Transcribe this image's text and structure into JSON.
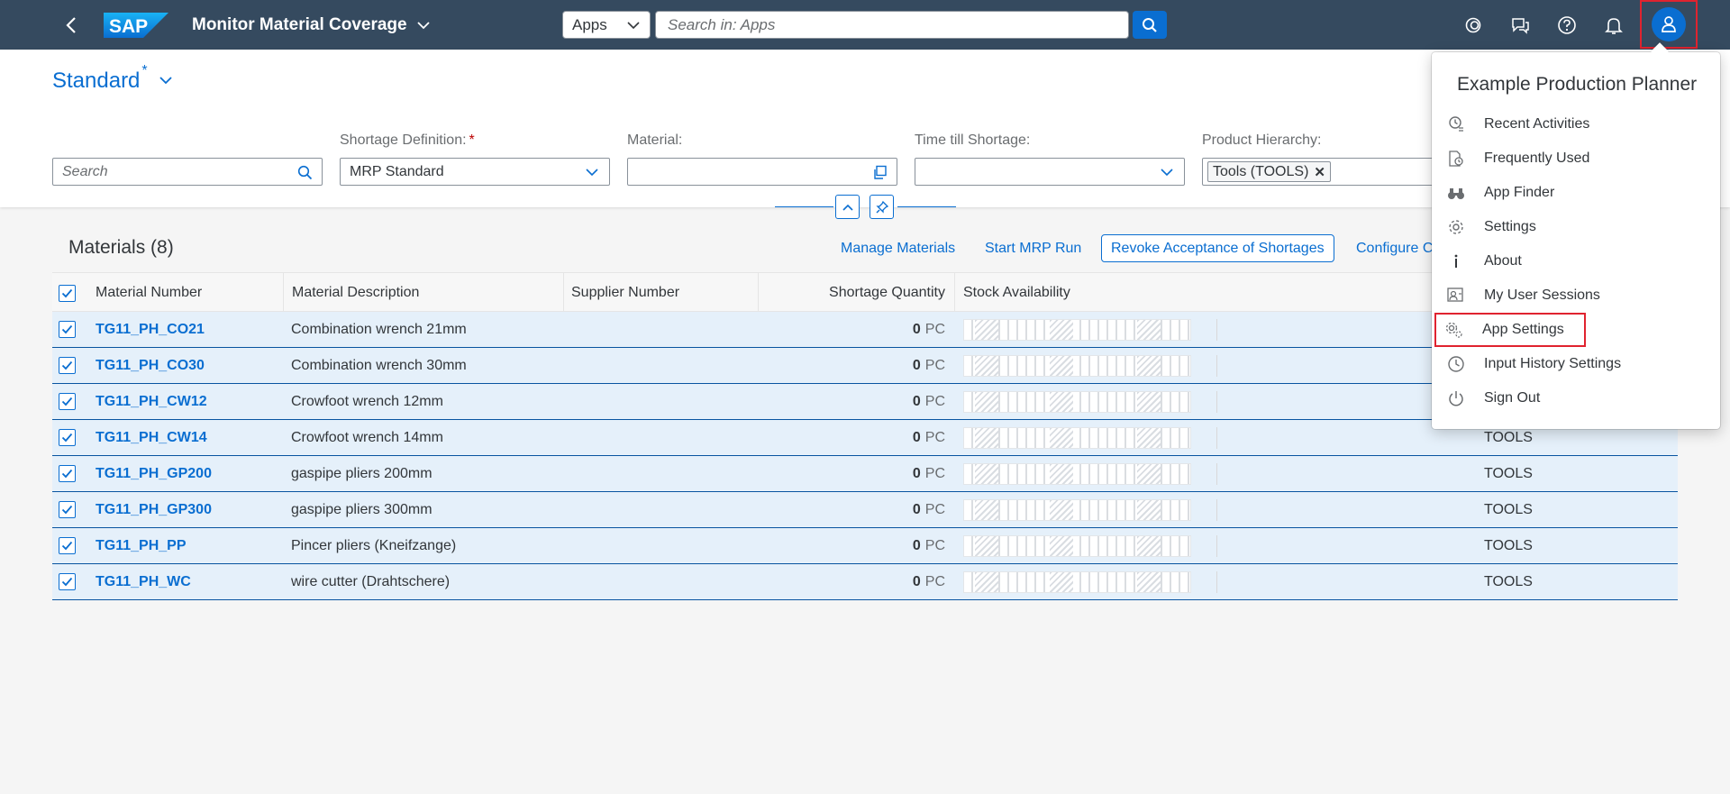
{
  "shell": {
    "title": "Monitor Material Coverage",
    "scope": "Apps",
    "search_placeholder": "Search in: Apps"
  },
  "variant": {
    "name": "Standard",
    "modified_marker": "*"
  },
  "filters": {
    "search_placeholder": "Search",
    "shortage_definition": {
      "label": "Shortage Definition:",
      "required_marker": "*",
      "value": "MRP Standard"
    },
    "material": {
      "label": "Material:",
      "value": ""
    },
    "time_till_shortage": {
      "label": "Time till Shortage:",
      "value": ""
    },
    "product_hierarchy": {
      "label": "Product Hierarchy:",
      "token": "Tools (TOOLS)"
    }
  },
  "table": {
    "title": "Materials (8)",
    "actions": [
      "Manage Materials",
      "Start MRP Run",
      "Revoke Acceptance of Shortages",
      "Configure C"
    ],
    "columns": [
      "Material Number",
      "Material Description",
      "Supplier Number",
      "Shortage Quantity",
      "Stock Availability"
    ],
    "rows": [
      {
        "number": "TG11_PH_CO21",
        "description": "Combination wrench 21mm",
        "supplier": "",
        "qty": "0",
        "unit": "PC",
        "hierarchy": ""
      },
      {
        "number": "TG11_PH_CO30",
        "description": "Combination wrench 30mm",
        "supplier": "",
        "qty": "0",
        "unit": "PC",
        "hierarchy": ""
      },
      {
        "number": "TG11_PH_CW12",
        "description": "Crowfoot wrench 12mm",
        "supplier": "",
        "qty": "0",
        "unit": "PC",
        "hierarchy": ""
      },
      {
        "number": "TG11_PH_CW14",
        "description": "Crowfoot wrench 14mm",
        "supplier": "",
        "qty": "0",
        "unit": "PC",
        "hierarchy": "TOOLS"
      },
      {
        "number": "TG11_PH_GP200",
        "description": "gaspipe pliers 200mm",
        "supplier": "",
        "qty": "0",
        "unit": "PC",
        "hierarchy": "TOOLS"
      },
      {
        "number": "TG11_PH_GP300",
        "description": "gaspipe pliers 300mm",
        "supplier": "",
        "qty": "0",
        "unit": "PC",
        "hierarchy": "TOOLS"
      },
      {
        "number": "TG11_PH_PP",
        "description": "Pincer pliers (Kneifzange)",
        "supplier": "",
        "qty": "0",
        "unit": "PC",
        "hierarchy": "TOOLS"
      },
      {
        "number": "TG11_PH_WC",
        "description": "wire cutter (Drahtschere)",
        "supplier": "",
        "qty": "0",
        "unit": "PC",
        "hierarchy": "TOOLS"
      }
    ]
  },
  "user_menu": {
    "user_name": "Example Production Planner",
    "items": [
      {
        "label": "Recent Activities",
        "icon": "recent-activities-icon"
      },
      {
        "label": "Frequently Used",
        "icon": "frequently-used-icon"
      },
      {
        "label": "App Finder",
        "icon": "binoculars-icon"
      },
      {
        "label": "Settings",
        "icon": "gear-icon"
      },
      {
        "label": "About",
        "icon": "info-icon"
      },
      {
        "label": "My User Sessions",
        "icon": "user-sessions-icon"
      },
      {
        "label": "App Settings",
        "icon": "app-settings-icon"
      },
      {
        "label": "Input History Settings",
        "icon": "history-icon"
      },
      {
        "label": "Sign Out",
        "icon": "power-icon"
      }
    ]
  },
  "colors": {
    "shell": "#354a5f",
    "accent": "#0a6ed1",
    "selected_row": "#e5f0fa",
    "highlight_box": "#e0232f"
  }
}
